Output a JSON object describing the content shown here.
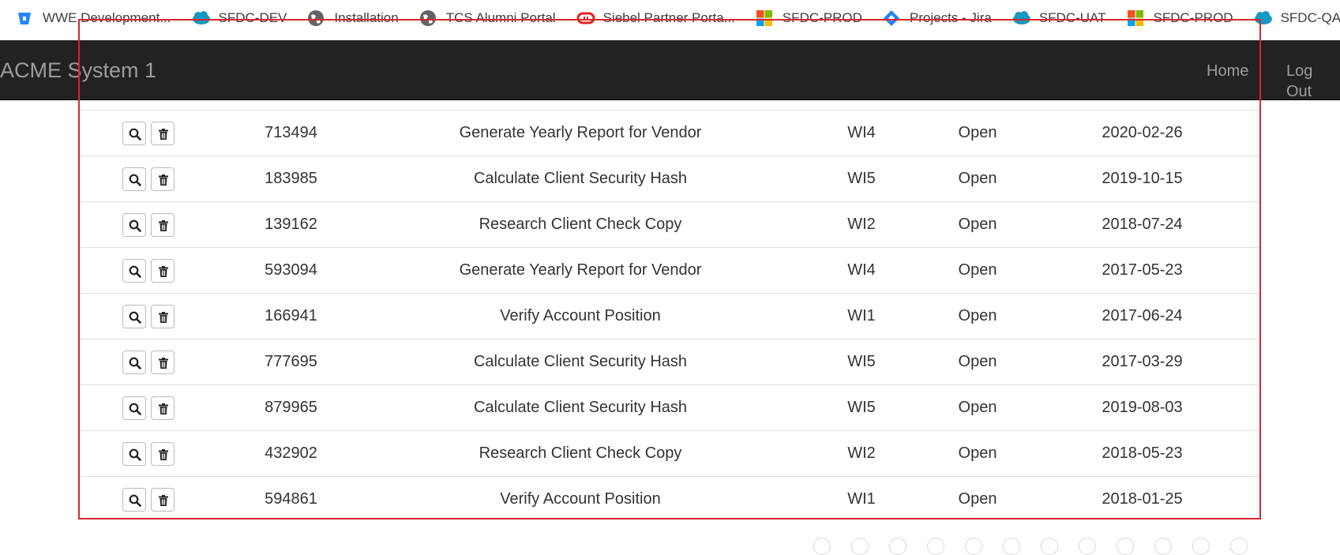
{
  "bookmarks": [
    {
      "label": "WWE Development...",
      "icon": "bitbucket-icon",
      "color": "#2684ff"
    },
    {
      "label": "SFDC-DEV",
      "icon": "salesforce-cloud-icon",
      "color": "#1798c1"
    },
    {
      "label": "Installation",
      "icon": "globe-icon",
      "color": "#5f6368"
    },
    {
      "label": "TCS Alumni Portal",
      "icon": "globe-icon",
      "color": "#5f6368"
    },
    {
      "label": "Siebel Partner Porta...",
      "icon": "oracle-icon",
      "color": "#e2231a"
    },
    {
      "label": "SFDC-PROD",
      "icon": "microsoft-icon",
      "color": "#f25022"
    },
    {
      "label": "Projects - Jira",
      "icon": "jira-icon",
      "color": "#2684ff"
    },
    {
      "label": "SFDC-UAT",
      "icon": "salesforce-cloud-icon",
      "color": "#1798c1"
    },
    {
      "label": "SFDC-PROD",
      "icon": "microsoft-icon",
      "color": "#f25022"
    },
    {
      "label": "SFDC-QA",
      "icon": "salesforce-cloud-icon",
      "color": "#1798c1"
    }
  ],
  "navbar": {
    "brand": "ACME System 1",
    "home": "Home",
    "logout": "Log Out"
  },
  "table": {
    "rows": [
      {
        "id": "713494",
        "title": "Generate Yearly Report for Vendor",
        "type": "WI4",
        "status": "Open",
        "date": "2020-02-26"
      },
      {
        "id": "183985",
        "title": "Calculate Client Security Hash",
        "type": "WI5",
        "status": "Open",
        "date": "2019-10-15"
      },
      {
        "id": "139162",
        "title": "Research Client Check Copy",
        "type": "WI2",
        "status": "Open",
        "date": "2018-07-24"
      },
      {
        "id": "593094",
        "title": "Generate Yearly Report for Vendor",
        "type": "WI4",
        "status": "Open",
        "date": "2017-05-23"
      },
      {
        "id": "166941",
        "title": "Verify Account Position",
        "type": "WI1",
        "status": "Open",
        "date": "2017-06-24"
      },
      {
        "id": "777695",
        "title": "Calculate Client Security Hash",
        "type": "WI5",
        "status": "Open",
        "date": "2017-03-29"
      },
      {
        "id": "879965",
        "title": "Calculate Client Security Hash",
        "type": "WI5",
        "status": "Open",
        "date": "2019-08-03"
      },
      {
        "id": "432902",
        "title": "Research Client Check Copy",
        "type": "WI2",
        "status": "Open",
        "date": "2018-05-23"
      },
      {
        "id": "594861",
        "title": "Verify Account Position",
        "type": "WI1",
        "status": "Open",
        "date": "2018-01-25"
      }
    ],
    "row_actions": [
      "search-icon",
      "trash-icon"
    ]
  },
  "colors": {
    "navbar_bg": "#222222",
    "navbar_text": "#9d9d9d",
    "highlight_border": "#d9262c",
    "row_border": "#dddddd"
  }
}
